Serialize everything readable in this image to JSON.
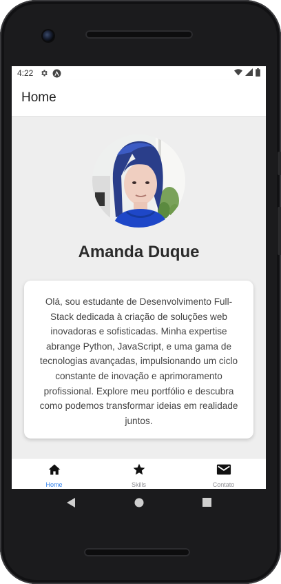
{
  "status_bar": {
    "time": "4:22",
    "icons": [
      "settings-icon",
      "app-notification-icon",
      "wifi-icon",
      "signal-icon",
      "battery-icon"
    ]
  },
  "header": {
    "title": "Home"
  },
  "profile": {
    "name": "Amanda Duque",
    "bio": "Olá, sou estudante de Desenvolvimento Full-Stack dedicada à criação de soluções web inovadoras e sofisticadas. Minha expertise abrange Python, JavaScript, e uma gama de tecnologias avançadas, impulsionando um ciclo constante de inovação e aprimoramento profissional. Explore meu portfólio e descubra como podemos transformar ideias em realidade juntos."
  },
  "tabs": [
    {
      "label": "Home",
      "icon": "home-icon",
      "active": true
    },
    {
      "label": "Skills",
      "icon": "star-icon",
      "active": false
    },
    {
      "label": "Contato",
      "icon": "mail-icon",
      "active": false
    }
  ],
  "colors": {
    "accent": "#2f80ed",
    "background": "#eeeeee",
    "card": "#ffffff",
    "inactive_tab": "#8e8e93"
  }
}
